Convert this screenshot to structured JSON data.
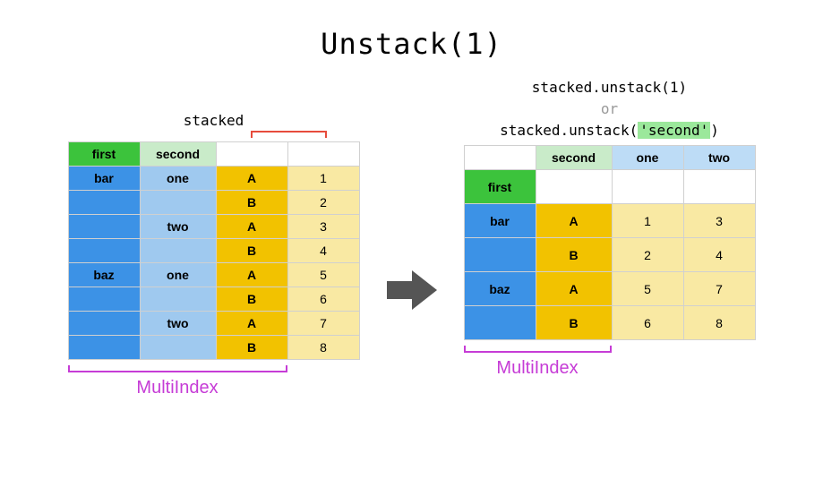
{
  "title": "Unstack(1)",
  "left": {
    "caption": "stacked",
    "headers": {
      "first": "first",
      "second": "second"
    },
    "rows": [
      {
        "first": "bar",
        "second": "one",
        "col": "A",
        "val": "1"
      },
      {
        "first": "",
        "second": "",
        "col": "B",
        "val": "2"
      },
      {
        "first": "",
        "second": "two",
        "col": "A",
        "val": "3"
      },
      {
        "first": "",
        "second": "",
        "col": "B",
        "val": "4"
      },
      {
        "first": "baz",
        "second": "one",
        "col": "A",
        "val": "5"
      },
      {
        "first": "",
        "second": "",
        "col": "B",
        "val": "6"
      },
      {
        "first": "",
        "second": "two",
        "col": "A",
        "val": "7"
      },
      {
        "first": "",
        "second": "",
        "col": "B",
        "val": "8"
      }
    ],
    "multiindex_label": "MultiIndex"
  },
  "right": {
    "code1": "stacked.unstack(1)",
    "code_or": "or",
    "code2a": "stacked.unstack(",
    "code2b": "'second'",
    "code2c": ")",
    "headers": {
      "second": "second",
      "one": "one",
      "two": "two",
      "first": "first"
    },
    "rows": [
      {
        "first": "bar",
        "col": "A",
        "one": "1",
        "two": "3"
      },
      {
        "first": "",
        "col": "B",
        "one": "2",
        "two": "4"
      },
      {
        "first": "baz",
        "col": "A",
        "one": "5",
        "two": "7"
      },
      {
        "first": "",
        "col": "B",
        "one": "6",
        "two": "8"
      }
    ],
    "multiindex_label": "MultiIndex"
  }
}
